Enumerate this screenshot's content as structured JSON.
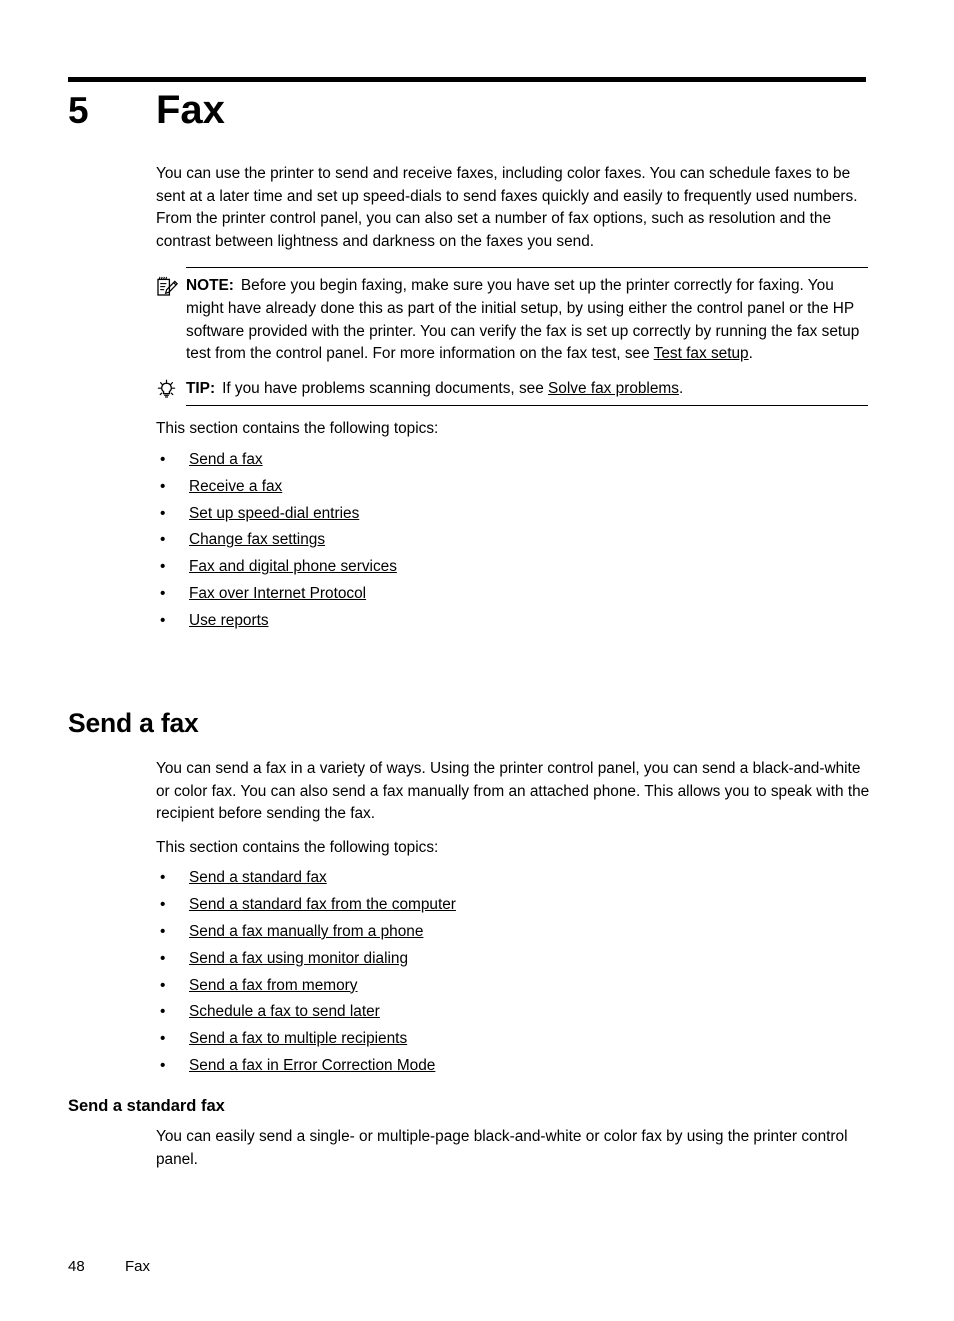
{
  "chapter": {
    "number": "5",
    "title": "Fax"
  },
  "intro": {
    "paragraph": "You can use the printer to send and receive faxes, including color faxes. You can schedule faxes to be sent at a later time and set up speed-dials to send faxes quickly and easily to frequently used numbers. From the printer control panel, you can also set a number of fax options, such as resolution and the contrast between lightness and darkness on the faxes you send."
  },
  "note": {
    "icon": "note-pencil-icon",
    "label": "NOTE:",
    "text_before_link": "Before you begin faxing, make sure you have set up the printer correctly for faxing. You might have already done this as part of the initial setup, by using either the control panel or the HP software provided with the printer. You can verify the fax is set up correctly by running the fax setup test from the control panel. For more information on the fax test, see ",
    "link": "Test fax setup",
    "text_after_link": "."
  },
  "tip": {
    "icon": "lightbulb-icon",
    "label": "TIP:",
    "text_before_link": "If you have problems scanning documents, see ",
    "link": "Solve fax problems",
    "text_after_link": "."
  },
  "topics_intro": "This section contains the following topics:",
  "chapter_topics": [
    "Send a fax",
    "Receive a fax",
    "Set up speed-dial entries",
    "Change fax settings",
    "Fax and digital phone services",
    "Fax over Internet Protocol",
    "Use reports"
  ],
  "section_send_a_fax": {
    "heading": "Send a fax",
    "paragraph": "You can send a fax in a variety of ways. Using the printer control panel, you can send a black-and-white or color fax. You can also send a fax manually from an attached phone. This allows you to speak with the recipient before sending the fax.",
    "topics_intro": "This section contains the following topics:",
    "topics": [
      "Send a standard fax",
      "Send a standard fax from the computer",
      "Send a fax manually from a phone",
      "Send a fax using monitor dialing",
      "Send a fax from memory",
      "Schedule a fax to send later",
      "Send a fax to multiple recipients",
      "Send a fax in Error Correction Mode"
    ]
  },
  "subsection_send_standard_fax": {
    "heading": "Send a standard fax",
    "paragraph": "You can easily send a single- or multiple-page black-and-white or color fax by using the printer control panel."
  },
  "bullet_glyph": "•",
  "footer": {
    "page_number": "48",
    "chapter_label": "Fax"
  },
  "colors": {
    "text": "#000000",
    "background": "#ffffff",
    "rule": "#000000"
  }
}
